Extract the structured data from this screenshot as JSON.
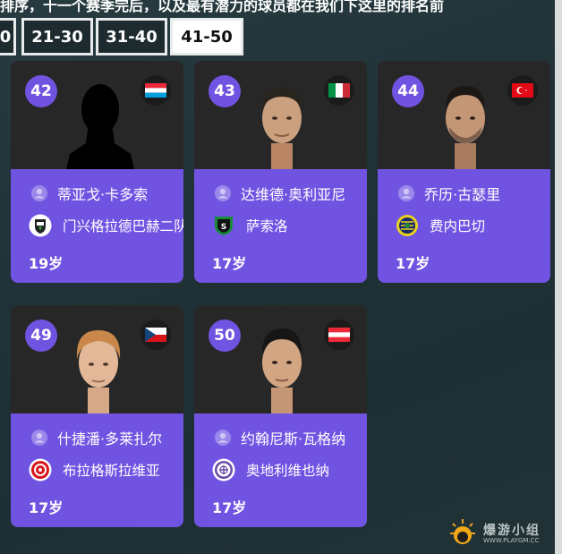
{
  "header": {
    "title_partial": "排序，十一个赛季完后，以及最有潜力的球员都在我们下这里的排名前"
  },
  "tabs": [
    {
      "label": "0",
      "active": false
    },
    {
      "label": "21-30",
      "active": false
    },
    {
      "label": "31-40",
      "active": false
    },
    {
      "label": "41-50",
      "active": true
    }
  ],
  "players": [
    {
      "rank": "42",
      "name": "蒂亚戈·卡多索",
      "club": "门兴格拉德巴赫二队",
      "age": "19岁",
      "flag": "luxembourg-flag",
      "club_icon": "gladbach-crest-icon",
      "portrait": "silhouette-portrait"
    },
    {
      "rank": "43",
      "name": "达维德·奥利亚尼",
      "club": "萨索洛",
      "age": "17岁",
      "flag": "italy-flag",
      "club_icon": "sassuolo-crest-icon",
      "portrait": "player-portrait"
    },
    {
      "rank": "44",
      "name": "乔历·古瑟里",
      "club": "费内巴切",
      "age": "17岁",
      "flag": "turkey-flag",
      "club_icon": "fenerbahce-crest-icon",
      "portrait": "player-portrait"
    },
    {
      "rank": "49",
      "name": "什捷潘·多莱扎尔",
      "club": "布拉格斯拉维亚",
      "age": "17岁",
      "flag": "czech-flag",
      "club_icon": "slavia-crest-icon",
      "portrait": "player-portrait"
    },
    {
      "rank": "50",
      "name": "约翰尼斯·瓦格纳",
      "club": "奥地利维也纳",
      "age": "17岁",
      "flag": "austria-flag",
      "club_icon": "austria-wien-crest-icon",
      "portrait": "player-portrait"
    }
  ],
  "watermark": {
    "main": "爆游小组",
    "sub": "WWW.PLAYGM.CC"
  },
  "colors": {
    "background": "#223438",
    "card_top": "#272727",
    "card_bottom": "#7153e2",
    "badge": "#7153e2",
    "tab_active_bg": "#ffffff",
    "tab_bg": "#1d2b2f"
  }
}
